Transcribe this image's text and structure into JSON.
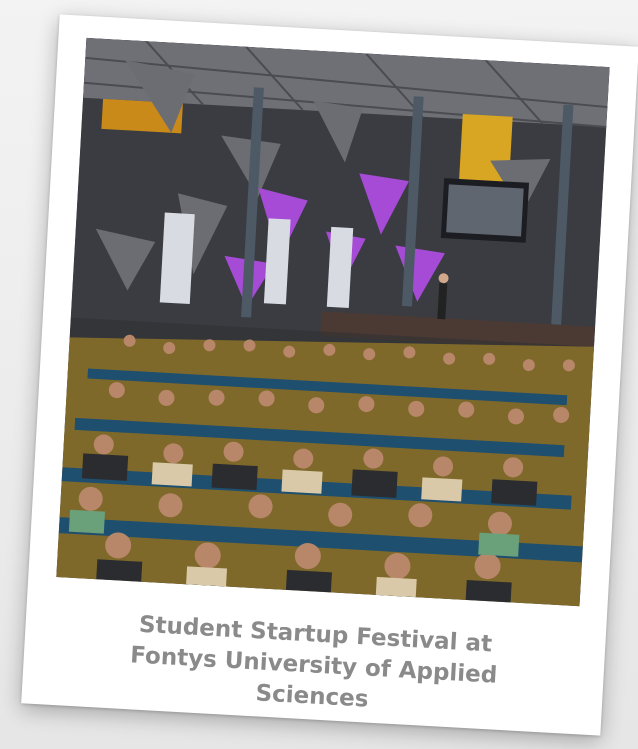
{
  "caption": {
    "line1": "Student Startup Festival at",
    "line2": "Fontys University of Applied",
    "line3": "Sciences"
  },
  "photo": {
    "subject": "event-audience-photo"
  },
  "colors": {
    "card": "#ffffff",
    "caption_text": "#8a8a8a",
    "accent_purple": "#9b3fd0",
    "accent_yellow": "#f2b01e"
  }
}
